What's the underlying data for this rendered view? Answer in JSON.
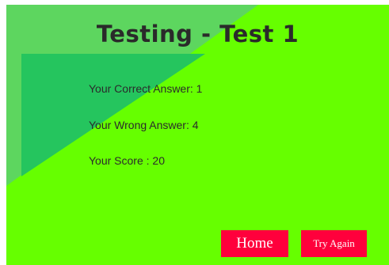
{
  "quiz": {
    "title": "Testing - Test 1"
  },
  "results": {
    "correct": "Your Correct Answer: 1",
    "wrong": "Your Wrong Answer: 4",
    "score": "Your Score : 20"
  },
  "actions": {
    "home_label": "Home",
    "try_again_label": "Try Again"
  },
  "colors": {
    "panel_background": "#66ff00",
    "overlay_light": "#5dd65f",
    "overlay_dark": "#25c55e",
    "button_background": "#ff003c",
    "button_text": "#ffffff",
    "title_text": "#2a2a2a"
  }
}
